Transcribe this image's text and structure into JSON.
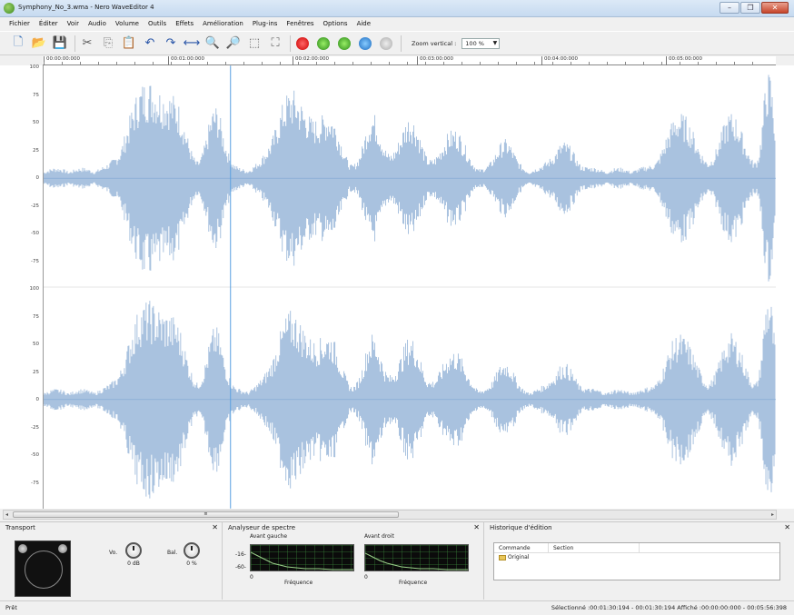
{
  "window": {
    "title": "Symphony_No_3.wma - Nero WaveEditor 4"
  },
  "menu": [
    "Fichier",
    "Éditer",
    "Voir",
    "Audio",
    "Volume",
    "Outils",
    "Effets",
    "Amélioration",
    "Plug-ins",
    "Fenêtres",
    "Options",
    "Aide"
  ],
  "toolbar": {
    "buttons": [
      "new-file-icon",
      "open-folder-icon",
      "save-icon",
      "cut-icon",
      "copy-icon",
      "paste-icon",
      "undo-icon",
      "redo-icon",
      "fit-icon",
      "zoom-in-icon",
      "zoom-out-icon",
      "zoom-select-icon",
      "zoom-full-icon",
      "record-icon",
      "play-icon",
      "play-selection-icon",
      "loop-icon",
      "stop-icon"
    ],
    "zoom_label": "Zoom vertical :",
    "zoom_value": "100 %"
  },
  "timeline": {
    "ticks": [
      "00:00:00:000",
      "00:01:00:000",
      "00:02:00:000",
      "00:03:00:000",
      "00:04:00:000",
      "00:05:00:000"
    ]
  },
  "waveform": {
    "y_labels": [
      "100",
      "75",
      "50",
      "25",
      "0",
      "-25",
      "-50",
      "-75"
    ],
    "y_labels_bottom": [
      "100",
      "75",
      "50",
      "25",
      "0",
      "-25",
      "-50",
      "-75"
    ],
    "cursor_position": "00:01:30:194",
    "color": "#a9c2df"
  },
  "panels": {
    "transport": {
      "title": "Transport",
      "volume_label": "0 dB",
      "balance_label": "0 %",
      "vol_side": "Vo.",
      "bal_side": "Bal."
    },
    "spectre": {
      "title": "Analyseur de spectre",
      "left_label": "Avant gauche",
      "right_label": "Avant droit",
      "y_top": "-16-",
      "y_bot": "-60-",
      "x_zero": "0",
      "freq_label": "Fréquence"
    },
    "historique": {
      "title": "Historique d'édition",
      "col_command": "Commande",
      "col_section": "Section",
      "row": "Original"
    }
  },
  "status": {
    "left": "Prêt",
    "right": "Sélectionné :00:01:30:194 - 00:01:30:194   Affiché :00:00:00:000 - 00:05:56:398"
  }
}
